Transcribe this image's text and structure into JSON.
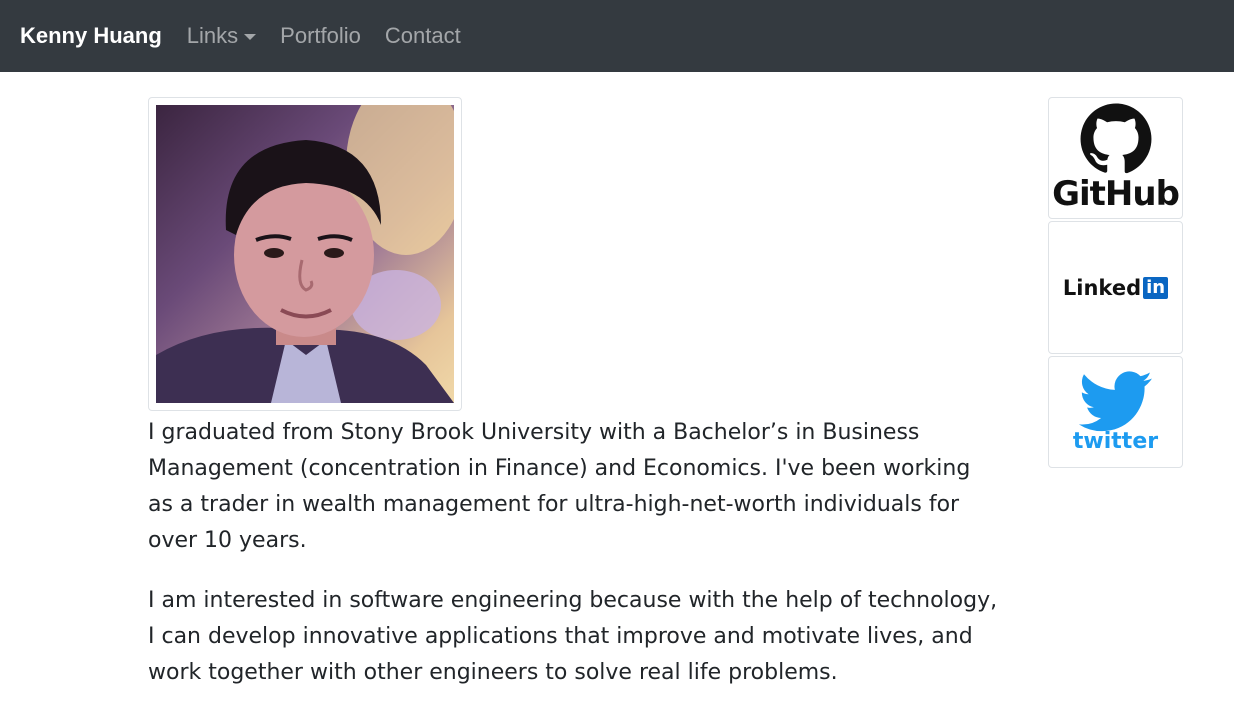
{
  "nav": {
    "brand": "Kenny Huang",
    "links": "Links",
    "portfolio": "Portfolio",
    "contact": "Contact"
  },
  "bio": {
    "paragraph1": "I graduated from Stony Brook University with a Bachelor’s in Business Management (concentration in Finance) and Economics. I've been working as a trader in wealth management for ultra-high-net-worth individuals for over 10 years.",
    "paragraph2": "I am interested in software engineering because with the help of technology, I can develop innovative applications that improve and motivate lives, and work together with other engineers to solve real life problems."
  },
  "social": {
    "github": "GitHub",
    "linkedin_text": "Linked",
    "linkedin_box": "in",
    "twitter": "twitter"
  },
  "colors": {
    "navbar": "#343a40",
    "linkedin": "#0a66c2",
    "twitter": "#1d9bf0"
  },
  "icons": [
    "caret-down-icon",
    "github-octocat-icon",
    "twitter-bird-icon"
  ]
}
